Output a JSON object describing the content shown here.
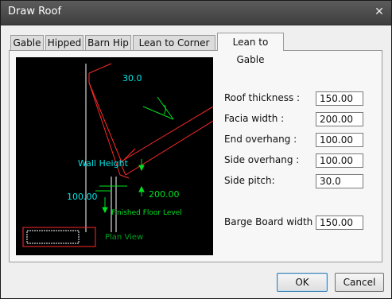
{
  "window": {
    "title": "Draw Roof",
    "close_glyph": "✕"
  },
  "tabs": [
    {
      "label": "Gable"
    },
    {
      "label": "Hipped"
    },
    {
      "label": "Barn Hip"
    },
    {
      "label": "Lean to Corner Hip"
    },
    {
      "label": "Lean to Gable",
      "active": true
    }
  ],
  "diagram": {
    "angle_label": "30.0",
    "wall_height": "Wall Height",
    "overhang_left": "100.00",
    "overhang_right": "200.00",
    "floor_level": "Finished Floor Level",
    "plan_view": "Plan View",
    "colors": {
      "roof": "#ff2a2a",
      "annot": "#00e5e5",
      "dims": "#00e020",
      "wall": "#ffffff"
    }
  },
  "fields": [
    {
      "label": "Roof thickness :",
      "value": "150.00"
    },
    {
      "label": "Facia width :",
      "value": "200.00"
    },
    {
      "label": "End overhang :",
      "value": "100.00"
    },
    {
      "label": "Side overhang :",
      "value": "100.00"
    },
    {
      "label": "Side pitch:",
      "value": "30.0"
    },
    {
      "label": "Barge Board width :",
      "value": "150.00"
    }
  ],
  "buttons": {
    "ok": "OK",
    "cancel": "Cancel"
  }
}
